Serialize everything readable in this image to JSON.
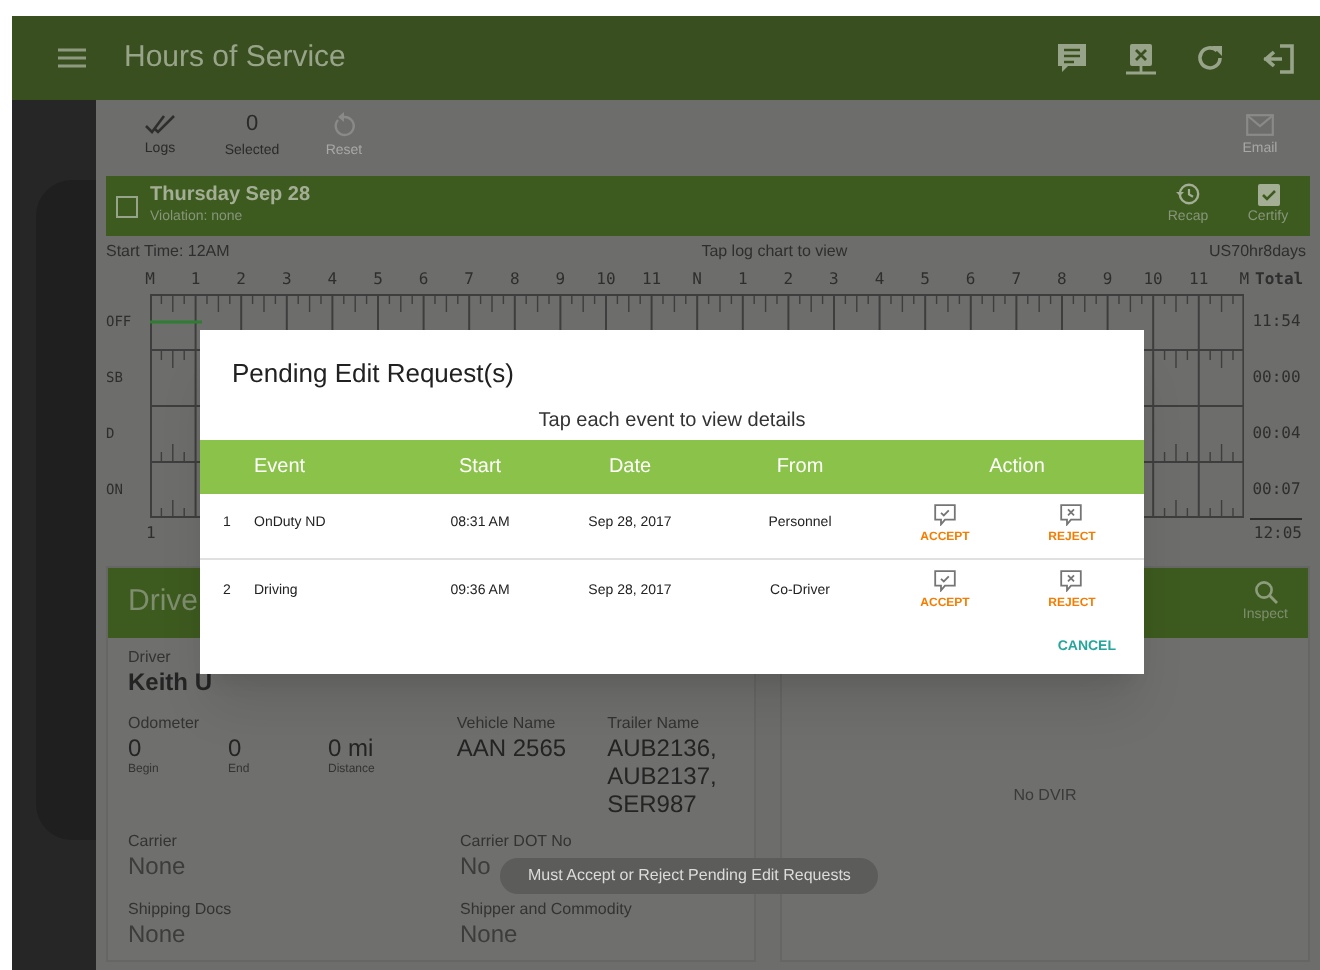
{
  "app_bar": {
    "title": "Hours of Service"
  },
  "toolbar": [
    {
      "kind": "icon",
      "label": "Logs",
      "disabled": false
    },
    {
      "kind": "count",
      "value": "0",
      "label": "Selected",
      "disabled": false
    },
    {
      "kind": "reset",
      "label": "Reset",
      "disabled": true
    },
    {
      "kind": "email",
      "label": "Email",
      "disabled": true
    }
  ],
  "day_bar": {
    "checked": false,
    "date": "Thursday Sep 28",
    "violation": "Violation: none",
    "actions": [
      {
        "kind": "recap",
        "label": "Recap"
      },
      {
        "kind": "certify",
        "label": "Certify"
      }
    ]
  },
  "log_chart": {
    "start_time": "Start Time: 12AM",
    "hint": "Tap log chart to view",
    "rule_set": "US70hr8days",
    "hours": [
      "M",
      "1",
      "2",
      "3",
      "4",
      "5",
      "6",
      "7",
      "8",
      "9",
      "10",
      "11",
      "N",
      "1",
      "2",
      "3",
      "4",
      "5",
      "6",
      "7",
      "8",
      "9",
      "10",
      "11",
      "M"
    ],
    "total_header": "Total",
    "rows": [
      {
        "label": "OFF",
        "total": "11:54"
      },
      {
        "label": "SB",
        "total": "00:00"
      },
      {
        "label": "D",
        "total": "00:04"
      },
      {
        "label": "ON",
        "total": "00:07"
      }
    ],
    "grand_total": "12:05",
    "page": "1"
  },
  "driver_card": {
    "title": "Drive",
    "driver": {
      "label": "Driver",
      "value": "Keith U"
    },
    "odometer": {
      "label": "Odometer",
      "readings": [
        {
          "value": "0",
          "caption": "Begin"
        },
        {
          "value": "0",
          "caption": "End"
        },
        {
          "value": "0 mi",
          "caption": "Distance"
        }
      ]
    },
    "vehicle": {
      "label": "Vehicle Name",
      "value": "AAN 2565"
    },
    "trailer": {
      "label": "Trailer Name",
      "value": "AUB2136, AUB2137, SER987"
    },
    "carrier": {
      "label": "Carrier",
      "value": "None"
    },
    "carrier_dot": {
      "label": "Carrier DOT No",
      "value": "No"
    },
    "shipping_docs": {
      "label": "Shipping Docs",
      "value": "None"
    },
    "shipper": {
      "label": "Shipper and Commodity",
      "value": "None"
    }
  },
  "dvir_card": {
    "inspect": "Inspect",
    "message": "No DVIR"
  },
  "dialog": {
    "title": "Pending Edit Request(s)",
    "subtitle": "Tap each event to view details",
    "columns": [
      "Event",
      "Start",
      "Date",
      "From",
      "Action"
    ],
    "rows": [
      {
        "number": "1",
        "event": "OnDuty ND",
        "start": "08:31 AM",
        "date": "Sep 28, 2017",
        "from": "Personnel",
        "accept": "ACCEPT",
        "reject": "REJECT"
      },
      {
        "number": "2",
        "event": "Driving",
        "start": "09:36 AM",
        "date": "Sep 28, 2017",
        "from": "Co-Driver",
        "accept": "ACCEPT",
        "reject": "REJECT"
      }
    ],
    "cancel": "CANCEL"
  },
  "toast": "Must Accept or Reject Pending Edit Requests"
}
